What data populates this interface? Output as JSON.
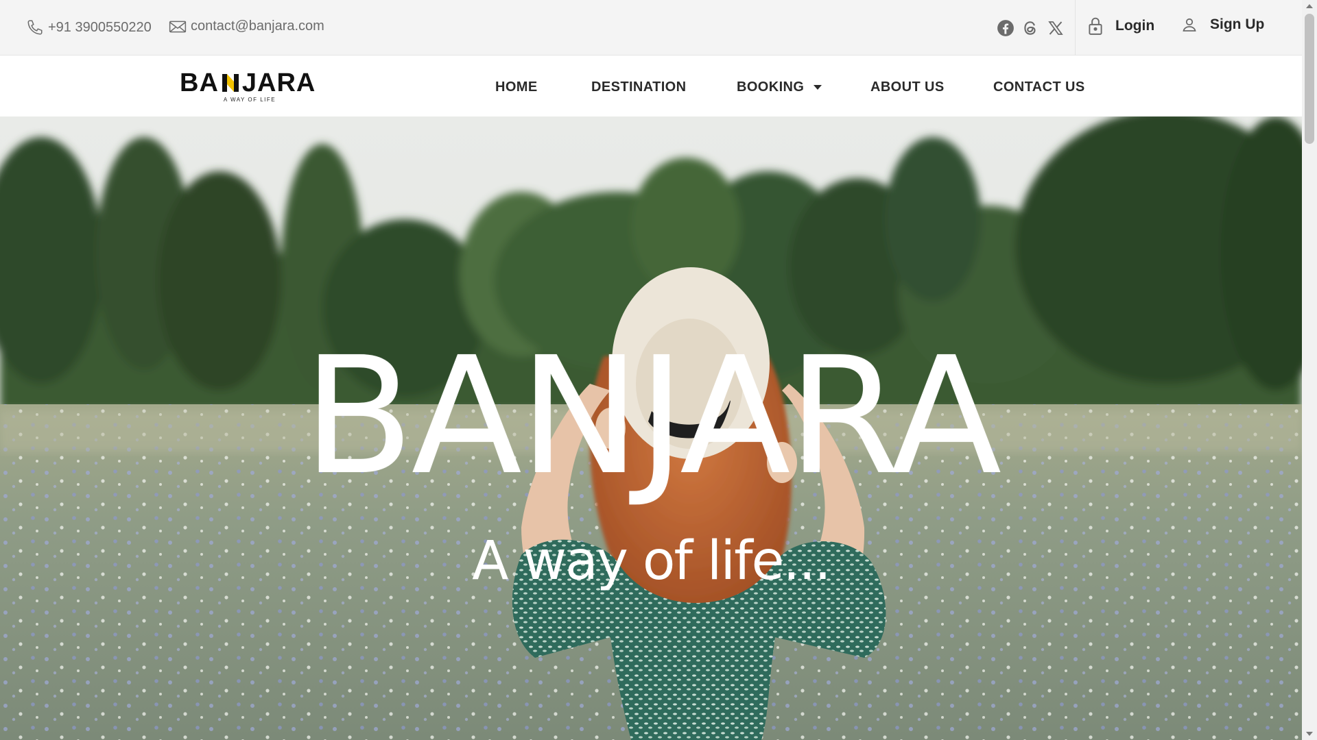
{
  "topbar": {
    "phone": "+91 3900550220",
    "email": "contact@banjara.com",
    "social": [
      "facebook-icon",
      "threads-icon",
      "x-icon"
    ],
    "login_label": "Login",
    "signup_label": "Sign Up"
  },
  "brand": {
    "name_left": "BA",
    "name_right": "JARA",
    "tagline": "A WAY OF LIFE",
    "accent": "#f2c200"
  },
  "nav": {
    "items": [
      {
        "label": "HOME"
      },
      {
        "label": "DESTINATION"
      },
      {
        "label": "BOOKING",
        "has_dropdown": true
      },
      {
        "label": "ABOUT US"
      },
      {
        "label": "CONTACT US"
      }
    ]
  },
  "hero": {
    "title": "BANJARA",
    "subtitle": "A way of life..."
  },
  "colors": {
    "topbar_bg": "#f4f4f4",
    "text_dark": "#2a2a2a",
    "text_muted": "#6b6b6b",
    "hero_text": "#ffffff"
  }
}
